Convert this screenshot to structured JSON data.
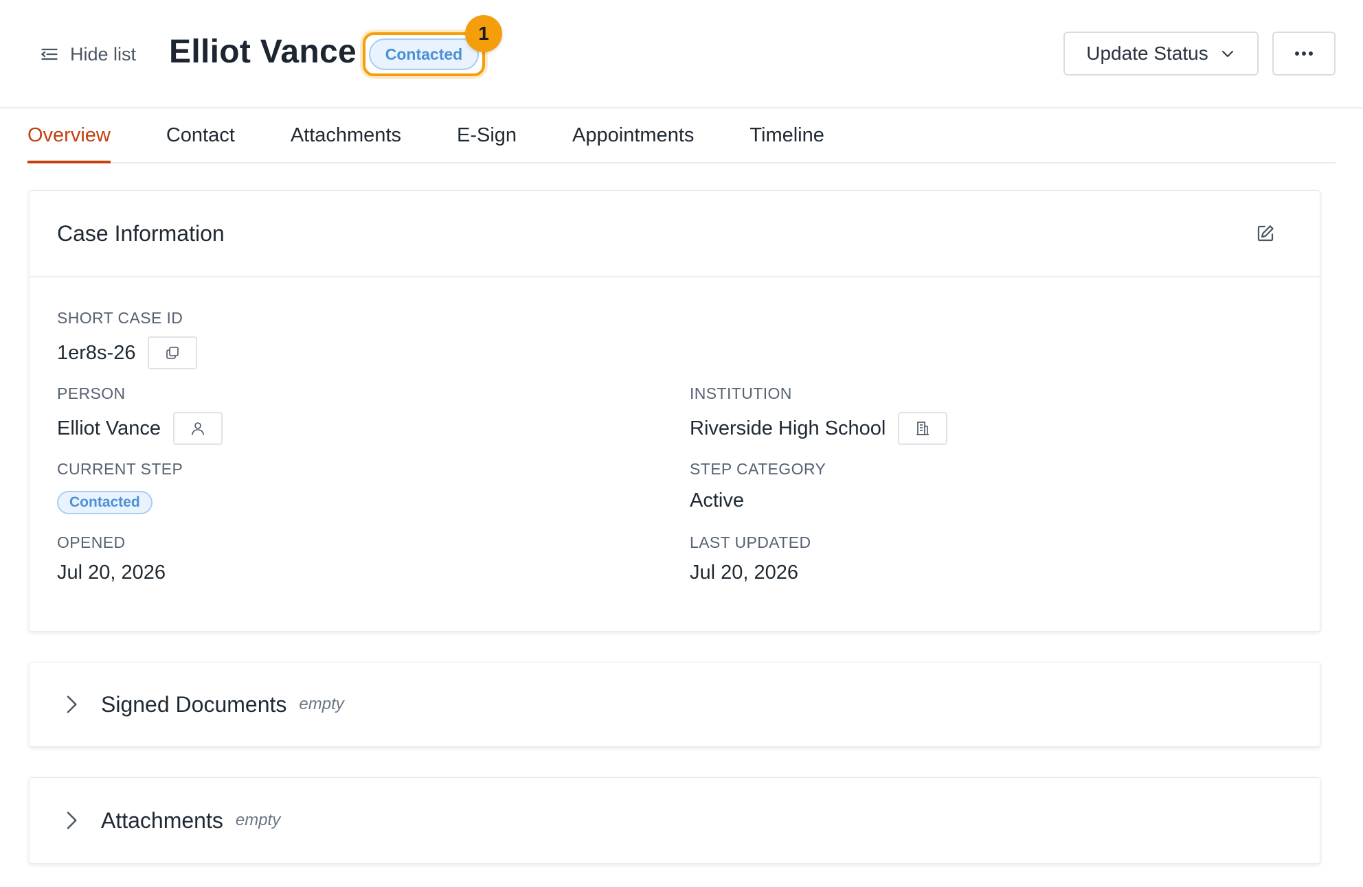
{
  "header": {
    "hide_list_label": "Hide list",
    "title": "Elliot Vance",
    "status_pill": "Contacted",
    "marker_number": "1",
    "update_status_label": "Update Status",
    "accent_color": "#f59e0b"
  },
  "tabs": [
    {
      "label": "Overview",
      "active": true
    },
    {
      "label": "Contact",
      "active": false
    },
    {
      "label": "Attachments",
      "active": false
    },
    {
      "label": "E-Sign",
      "active": false
    },
    {
      "label": "Appointments",
      "active": false
    },
    {
      "label": "Timeline",
      "active": false
    }
  ],
  "case_info": {
    "title": "Case Information",
    "short_case_id": {
      "label": "SHORT CASE ID",
      "value": "1er8s-26"
    },
    "person": {
      "label": "PERSON",
      "value": "Elliot Vance"
    },
    "institution": {
      "label": "INSTITUTION",
      "value": "Riverside High School"
    },
    "current_step": {
      "label": "CURRENT STEP",
      "value": "Contacted"
    },
    "step_category": {
      "label": "STEP CATEGORY",
      "value": "Active"
    },
    "opened": {
      "label": "OPENED",
      "value": "Jul 20, 2026"
    },
    "last_updated": {
      "label": "LAST UPDATED",
      "value": "Jul 20, 2026"
    }
  },
  "sections": [
    {
      "title": "Signed Documents",
      "note": "empty"
    },
    {
      "title": "Attachments",
      "note": "empty"
    }
  ],
  "icons": {
    "hide_list": "list-collapse-icon",
    "update_status": "chevron-down-icon",
    "more": "ellipsis-icon",
    "edit": "edit-icon",
    "copy": "copy-icon",
    "person": "user-icon",
    "institution": "building-icon",
    "expand": "chevron-right-icon"
  }
}
